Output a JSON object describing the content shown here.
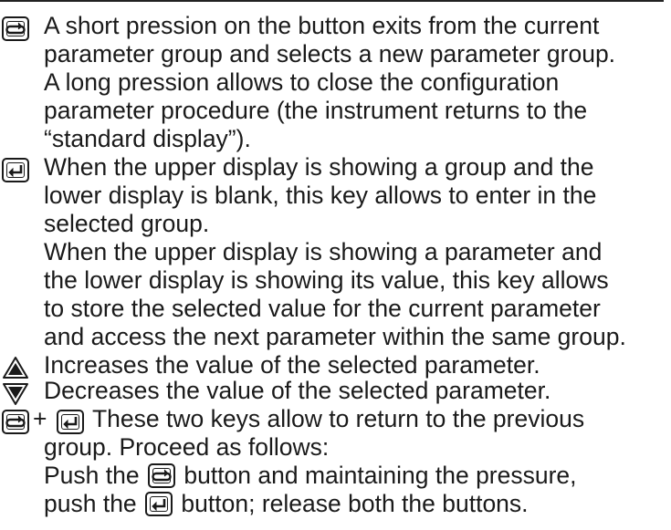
{
  "keys": {
    "function_key_icon": "function-key-icon",
    "enter_key_icon": "enter-key-icon",
    "up_key_icon": "up-arrow-key-icon",
    "down_key_icon": "down-arrow-key-icon"
  },
  "entries": [
    {
      "key": "function",
      "lines": [
        "A short pression on the button exits from the current",
        "parameter group and selects a new parameter group.",
        "A long pression allows to close the configuration",
        "parameter procedure (the instrument returns to the",
        "“standard display”)."
      ]
    },
    {
      "key": "enter",
      "lines": [
        "When the upper display is showing a group and the",
        "lower display is blank, this key allows to enter in the",
        "selected group.",
        "When the upper display is showing a parameter and",
        "the lower display is showing its value, this key allows",
        "to store the selected value for the current parameter",
        "and access the next parameter within the same group."
      ]
    },
    {
      "key": "up",
      "lines": [
        "Increases the value of the selected parameter."
      ]
    },
    {
      "key": "down",
      "lines": [
        "Decreases the value of the selected parameter."
      ]
    },
    {
      "key": "function+enter",
      "plus": "+",
      "first_line": "These two keys allow to return to the previous",
      "lines": [
        "group.  Proceed as follows:"
      ],
      "push_line_1_a": "Push the",
      "push_line_1_b": "button and maintaining the pressure,",
      "push_line_2_a": "push the",
      "push_line_2_b": "button; release both the buttons."
    }
  ]
}
